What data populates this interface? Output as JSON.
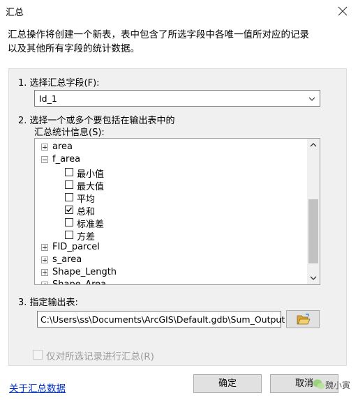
{
  "window": {
    "title": "汇总"
  },
  "description": {
    "line1": "汇总操作将创建一个新表，表中包含了所选字段中各唯一值所对应的记录",
    "line2": "以及其他所有字段的统计数据。"
  },
  "step1": {
    "label": "1. 选择汇总字段(F):",
    "selected_value": "Id_1"
  },
  "step2": {
    "label_line1": "2. 选择一个或多个要包括在输出表中的",
    "label_line2": "汇总统计信息(S):",
    "tree": [
      {
        "label": "area",
        "kind": "node",
        "state": "collapsed"
      },
      {
        "label": "f_area",
        "kind": "node",
        "state": "expanded"
      },
      {
        "label": "最小值",
        "kind": "leaf",
        "checked": false
      },
      {
        "label": "最大值",
        "kind": "leaf",
        "checked": false
      },
      {
        "label": "平均",
        "kind": "leaf",
        "checked": false
      },
      {
        "label": "总和",
        "kind": "leaf",
        "checked": true
      },
      {
        "label": "标准差",
        "kind": "leaf",
        "checked": false
      },
      {
        "label": "方差",
        "kind": "leaf",
        "checked": false
      },
      {
        "label": "FID_parcel",
        "kind": "node",
        "state": "collapsed"
      },
      {
        "label": "s_area",
        "kind": "node",
        "state": "collapsed"
      },
      {
        "label": "Shape_Length",
        "kind": "node",
        "state": "collapsed"
      },
      {
        "label": "Shape_Area",
        "kind": "node",
        "state": "collapsed"
      }
    ]
  },
  "step3": {
    "label": "3. 指定输出表:",
    "path": "C:\\Users\\ss\\Documents\\ArcGIS\\Default.gdb\\Sum_Output"
  },
  "selected_only": {
    "label": "仅对所选记录进行汇总(R)",
    "checked": false,
    "enabled": false
  },
  "footer": {
    "link": "关于汇总数据",
    "ok_label": "确定",
    "cancel_label": "取消",
    "watermark": "魏小寅"
  },
  "icons": {
    "close": "close-icon",
    "dropdown": "chevron-down-icon",
    "folder": "open-folder-icon",
    "scroll_up": "scroll-up-icon",
    "scroll_down": "scroll-down-icon",
    "watermark": "wechat-icon"
  },
  "colors": {
    "link": "#0033cc",
    "folder": "#e8b84a",
    "wechat": "#8fcf6b"
  }
}
